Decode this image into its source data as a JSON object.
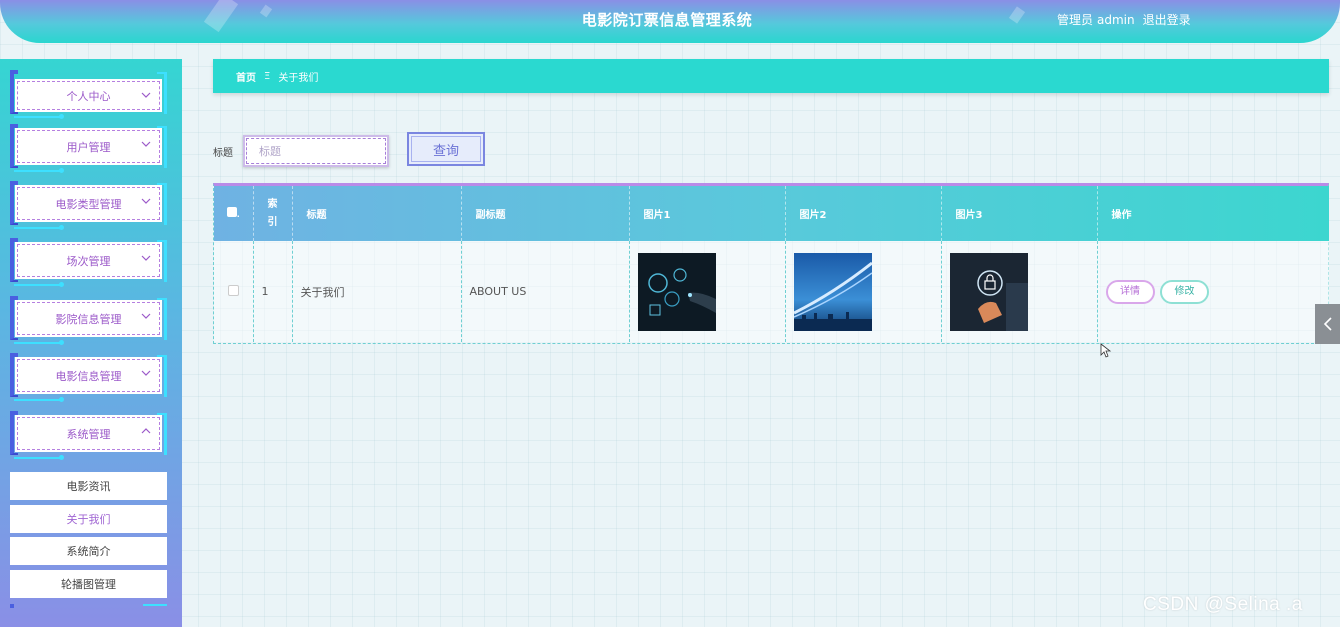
{
  "header": {
    "title": "电影院订票信息管理系统",
    "user_role": "管理员",
    "username": "admin",
    "logout": "退出登录"
  },
  "sidebar": {
    "items": [
      {
        "label": "个人中心"
      },
      {
        "label": "用户管理"
      },
      {
        "label": "电影类型管理"
      },
      {
        "label": "场次管理"
      },
      {
        "label": "影院信息管理"
      },
      {
        "label": "电影信息管理"
      },
      {
        "label": "系统管理",
        "expanded": true
      }
    ],
    "submenu": [
      {
        "label": "电影资讯"
      },
      {
        "label": "关于我们",
        "active": true
      },
      {
        "label": "系统简介"
      },
      {
        "label": "轮播图管理"
      }
    ]
  },
  "breadcrumb": {
    "home": "首页",
    "separator": "Ξ",
    "current": "关于我们"
  },
  "search": {
    "label": "标题",
    "placeholder": "标题",
    "button": "查询"
  },
  "table": {
    "headers": {
      "index": "索引",
      "title": "标题",
      "subtitle": "副标题",
      "image1": "图片1",
      "image2": "图片2",
      "image3": "图片3",
      "actions": "操作"
    },
    "rows": [
      {
        "index": "1",
        "title": "关于我们",
        "subtitle": "ABOUT US",
        "detail": "详情",
        "edit": "修改"
      }
    ]
  },
  "watermark": "CSDN @Selina .a",
  "colors": {
    "accent_teal": "#2ad9d0",
    "accent_purple": "#8a8fe6",
    "menu_text": "#9b59c9"
  }
}
